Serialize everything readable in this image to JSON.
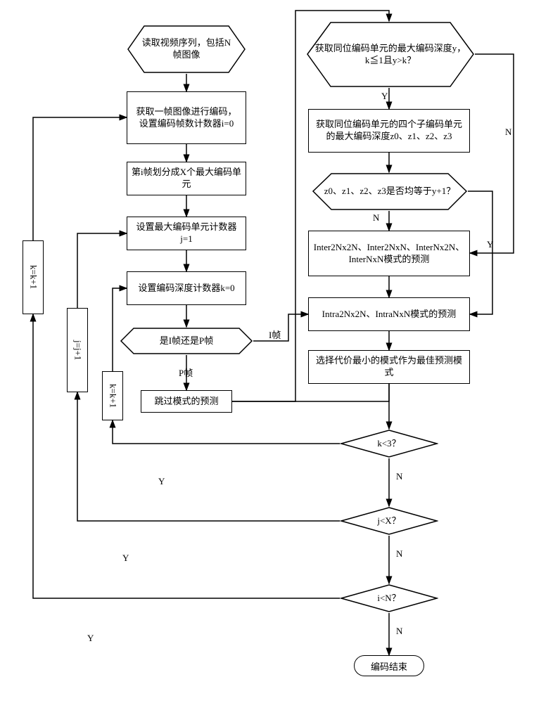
{
  "nodes": {
    "start": "读取视频序列，包括N帧图像",
    "b1": "获取一帧图像进行编码，\n设置编码帧数计数器i=0",
    "b2": "第i帧划分成X个最大编码单元",
    "b3": "设置最大编码单元计数器j=1",
    "b4": "设置编码深度计数器k=0",
    "d_frame": "是I帧还是P帧",
    "b_skip": "跳过模式的预测",
    "d_y": "获取同位编码单元的最大编码深度y，\nk≦1且y>k？",
    "b_sub": "获取同位编码单元的四个子编码单元的最大编码深度z0、z1、z2、z3",
    "d_z": "z0、z1、z2、z3是否均等于y+1？",
    "b_inter": "Inter2Nx2N、Inter2NxN、InterNx2N、InterNxN模式的预测",
    "b_intra": "Intra2Nx2N、IntraNxN模式的预测",
    "b_best": "选择代价最小的模式作为最佳预测模式",
    "d_k3": "k<3？",
    "d_jx": "j<X？",
    "d_in": "i<N？",
    "end": "编码结束",
    "inc_k_left": "k=k+1",
    "inc_j": "j=j+1",
    "inc_k_right": "k=k+1"
  },
  "edge_labels": {
    "Y": "Y",
    "N": "N",
    "I": "I帧",
    "P": "P帧"
  }
}
